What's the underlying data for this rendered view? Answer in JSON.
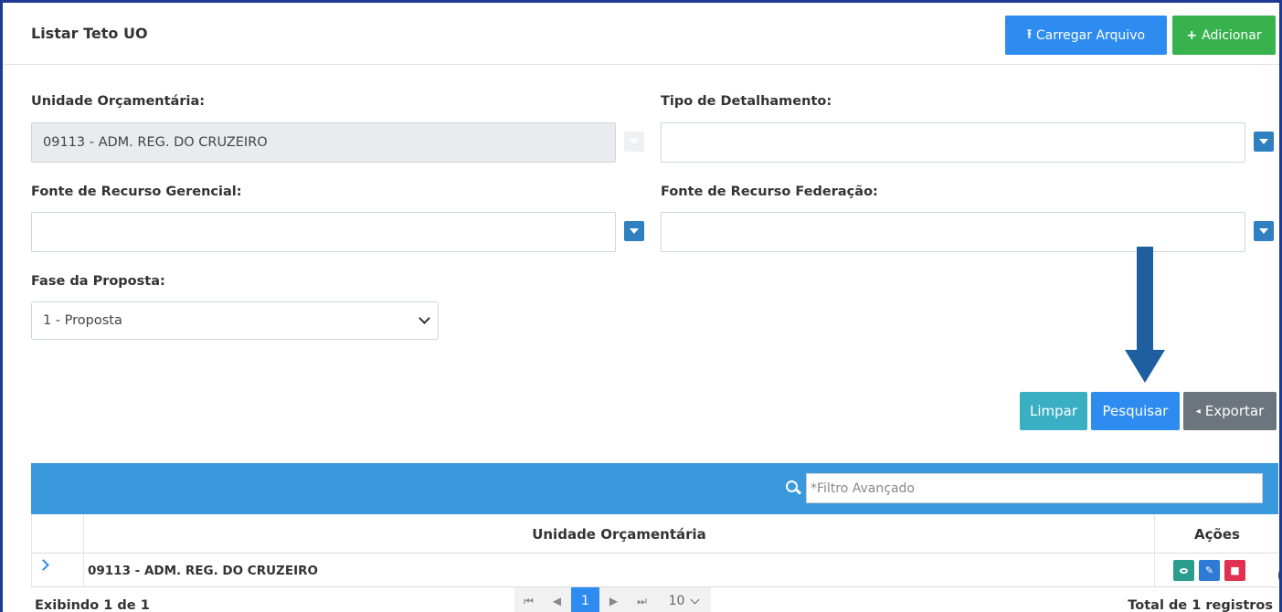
{
  "header": {
    "title": "Listar Teto UO",
    "upload_label": "Carregar Arquivo",
    "add_label": "Adicionar"
  },
  "form": {
    "unidade_label": "Unidade Orçamentária:",
    "unidade_value": "09113 - ADM. REG. DO CRUZEIRO",
    "tipo_label": "Tipo de Detalhamento:",
    "tipo_value": "",
    "fonte_gerencial_label": "Fonte de Recurso Gerencial:",
    "fonte_gerencial_value": "",
    "fonte_federacao_label": "Fonte de Recurso Federação:",
    "fonte_federacao_value": "",
    "fase_label": "Fase da Proposta:",
    "fase_value": "1 - Proposta"
  },
  "actions": {
    "limpar": "Limpar",
    "pesquisar": "Pesquisar",
    "exportar": "Exportar"
  },
  "grid": {
    "filter_placeholder": "*Filtro Avançado",
    "columns": [
      "Unidade Orçamentária",
      "Ações"
    ],
    "rows": [
      {
        "unidade": "09113 - ADM. REG. DO CRUZEIRO"
      }
    ]
  },
  "footer": {
    "showing": "Exibindo 1 de 1",
    "current_page": "1",
    "page_size": "10",
    "total": "Total de 1 registros"
  },
  "colors": {
    "primary": "#2e8cf0",
    "success": "#37b24d",
    "info": "#3aafc4",
    "secondary": "#6c757d",
    "grid_bar": "#3a98dc",
    "annotation_arrow": "#1e5fa0"
  }
}
